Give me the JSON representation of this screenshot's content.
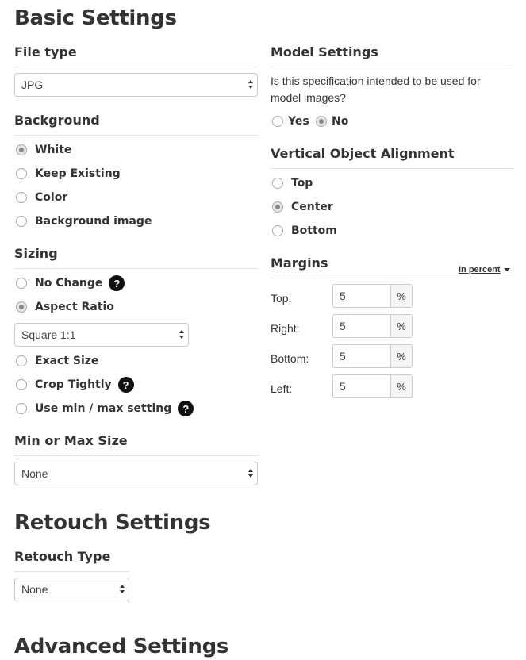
{
  "basic": {
    "title": "Basic Settings",
    "file_type": {
      "label": "File type",
      "value": "JPG"
    },
    "background": {
      "label": "Background",
      "options": [
        "White",
        "Keep Existing",
        "Color",
        "Background image"
      ],
      "selected": "White"
    },
    "sizing": {
      "label": "Sizing",
      "opt_no_change": "No Change",
      "opt_aspect": "Aspect Ratio",
      "aspect_value": "Square 1:1",
      "opt_exact": "Exact Size",
      "opt_crop": "Crop Tightly",
      "opt_minmax": "Use min / max setting",
      "selected": "Aspect Ratio",
      "help_glyph": "?"
    },
    "min_max": {
      "label": "Min or Max Size",
      "value": "None"
    }
  },
  "model": {
    "label": "Model Settings",
    "question": "Is this specification intended to be used for model images?",
    "yes": "Yes",
    "no": "No",
    "selected": "No"
  },
  "alignment": {
    "label": "Vertical Object Alignment",
    "options": [
      "Top",
      "Center",
      "Bottom"
    ],
    "selected": "Center"
  },
  "margins": {
    "label": "Margins",
    "mode": "In percent",
    "rows": [
      {
        "label": "Top:",
        "value": "5",
        "unit": "%"
      },
      {
        "label": "Right:",
        "value": "5",
        "unit": "%"
      },
      {
        "label": "Bottom:",
        "value": "5",
        "unit": "%"
      },
      {
        "label": "Left:",
        "value": "5",
        "unit": "%"
      }
    ]
  },
  "retouch": {
    "title": "Retouch Settings",
    "type_label": "Retouch Type",
    "value": "None"
  },
  "advanced": {
    "title": "Advanced Settings"
  },
  "colors": {
    "text": "#333333",
    "divider": "#e2e2e2",
    "help_bg": "#111111"
  }
}
